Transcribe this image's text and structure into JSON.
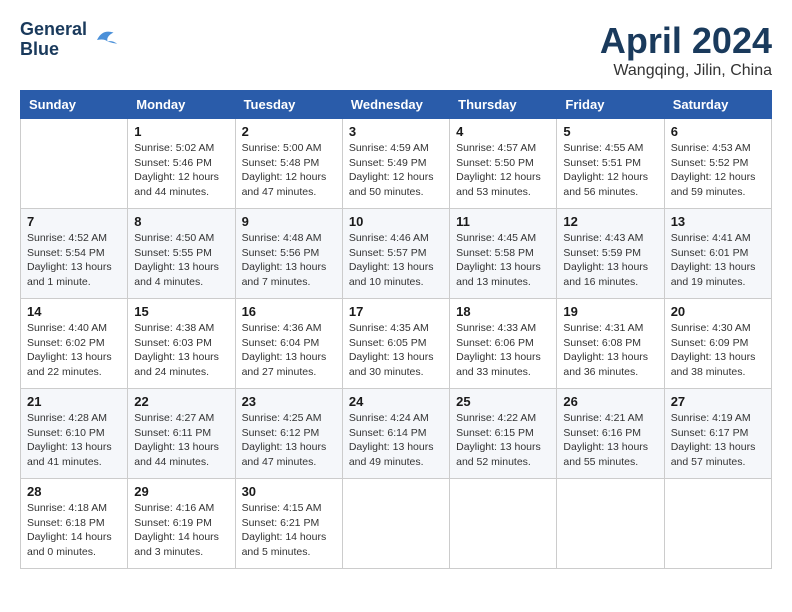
{
  "header": {
    "logo_line1": "General",
    "logo_line2": "Blue",
    "month": "April 2024",
    "location": "Wangqing, Jilin, China"
  },
  "columns": [
    "Sunday",
    "Monday",
    "Tuesday",
    "Wednesday",
    "Thursday",
    "Friday",
    "Saturday"
  ],
  "weeks": [
    [
      {
        "day": "",
        "sunrise": "",
        "sunset": "",
        "daylight": ""
      },
      {
        "day": "1",
        "sunrise": "Sunrise: 5:02 AM",
        "sunset": "Sunset: 5:46 PM",
        "daylight": "Daylight: 12 hours and 44 minutes."
      },
      {
        "day": "2",
        "sunrise": "Sunrise: 5:00 AM",
        "sunset": "Sunset: 5:48 PM",
        "daylight": "Daylight: 12 hours and 47 minutes."
      },
      {
        "day": "3",
        "sunrise": "Sunrise: 4:59 AM",
        "sunset": "Sunset: 5:49 PM",
        "daylight": "Daylight: 12 hours and 50 minutes."
      },
      {
        "day": "4",
        "sunrise": "Sunrise: 4:57 AM",
        "sunset": "Sunset: 5:50 PM",
        "daylight": "Daylight: 12 hours and 53 minutes."
      },
      {
        "day": "5",
        "sunrise": "Sunrise: 4:55 AM",
        "sunset": "Sunset: 5:51 PM",
        "daylight": "Daylight: 12 hours and 56 minutes."
      },
      {
        "day": "6",
        "sunrise": "Sunrise: 4:53 AM",
        "sunset": "Sunset: 5:52 PM",
        "daylight": "Daylight: 12 hours and 59 minutes."
      }
    ],
    [
      {
        "day": "7",
        "sunrise": "Sunrise: 4:52 AM",
        "sunset": "Sunset: 5:54 PM",
        "daylight": "Daylight: 13 hours and 1 minute."
      },
      {
        "day": "8",
        "sunrise": "Sunrise: 4:50 AM",
        "sunset": "Sunset: 5:55 PM",
        "daylight": "Daylight: 13 hours and 4 minutes."
      },
      {
        "day": "9",
        "sunrise": "Sunrise: 4:48 AM",
        "sunset": "Sunset: 5:56 PM",
        "daylight": "Daylight: 13 hours and 7 minutes."
      },
      {
        "day": "10",
        "sunrise": "Sunrise: 4:46 AM",
        "sunset": "Sunset: 5:57 PM",
        "daylight": "Daylight: 13 hours and 10 minutes."
      },
      {
        "day": "11",
        "sunrise": "Sunrise: 4:45 AM",
        "sunset": "Sunset: 5:58 PM",
        "daylight": "Daylight: 13 hours and 13 minutes."
      },
      {
        "day": "12",
        "sunrise": "Sunrise: 4:43 AM",
        "sunset": "Sunset: 5:59 PM",
        "daylight": "Daylight: 13 hours and 16 minutes."
      },
      {
        "day": "13",
        "sunrise": "Sunrise: 4:41 AM",
        "sunset": "Sunset: 6:01 PM",
        "daylight": "Daylight: 13 hours and 19 minutes."
      }
    ],
    [
      {
        "day": "14",
        "sunrise": "Sunrise: 4:40 AM",
        "sunset": "Sunset: 6:02 PM",
        "daylight": "Daylight: 13 hours and 22 minutes."
      },
      {
        "day": "15",
        "sunrise": "Sunrise: 4:38 AM",
        "sunset": "Sunset: 6:03 PM",
        "daylight": "Daylight: 13 hours and 24 minutes."
      },
      {
        "day": "16",
        "sunrise": "Sunrise: 4:36 AM",
        "sunset": "Sunset: 6:04 PM",
        "daylight": "Daylight: 13 hours and 27 minutes."
      },
      {
        "day": "17",
        "sunrise": "Sunrise: 4:35 AM",
        "sunset": "Sunset: 6:05 PM",
        "daylight": "Daylight: 13 hours and 30 minutes."
      },
      {
        "day": "18",
        "sunrise": "Sunrise: 4:33 AM",
        "sunset": "Sunset: 6:06 PM",
        "daylight": "Daylight: 13 hours and 33 minutes."
      },
      {
        "day": "19",
        "sunrise": "Sunrise: 4:31 AM",
        "sunset": "Sunset: 6:08 PM",
        "daylight": "Daylight: 13 hours and 36 minutes."
      },
      {
        "day": "20",
        "sunrise": "Sunrise: 4:30 AM",
        "sunset": "Sunset: 6:09 PM",
        "daylight": "Daylight: 13 hours and 38 minutes."
      }
    ],
    [
      {
        "day": "21",
        "sunrise": "Sunrise: 4:28 AM",
        "sunset": "Sunset: 6:10 PM",
        "daylight": "Daylight: 13 hours and 41 minutes."
      },
      {
        "day": "22",
        "sunrise": "Sunrise: 4:27 AM",
        "sunset": "Sunset: 6:11 PM",
        "daylight": "Daylight: 13 hours and 44 minutes."
      },
      {
        "day": "23",
        "sunrise": "Sunrise: 4:25 AM",
        "sunset": "Sunset: 6:12 PM",
        "daylight": "Daylight: 13 hours and 47 minutes."
      },
      {
        "day": "24",
        "sunrise": "Sunrise: 4:24 AM",
        "sunset": "Sunset: 6:14 PM",
        "daylight": "Daylight: 13 hours and 49 minutes."
      },
      {
        "day": "25",
        "sunrise": "Sunrise: 4:22 AM",
        "sunset": "Sunset: 6:15 PM",
        "daylight": "Daylight: 13 hours and 52 minutes."
      },
      {
        "day": "26",
        "sunrise": "Sunrise: 4:21 AM",
        "sunset": "Sunset: 6:16 PM",
        "daylight": "Daylight: 13 hours and 55 minutes."
      },
      {
        "day": "27",
        "sunrise": "Sunrise: 4:19 AM",
        "sunset": "Sunset: 6:17 PM",
        "daylight": "Daylight: 13 hours and 57 minutes."
      }
    ],
    [
      {
        "day": "28",
        "sunrise": "Sunrise: 4:18 AM",
        "sunset": "Sunset: 6:18 PM",
        "daylight": "Daylight: 14 hours and 0 minutes."
      },
      {
        "day": "29",
        "sunrise": "Sunrise: 4:16 AM",
        "sunset": "Sunset: 6:19 PM",
        "daylight": "Daylight: 14 hours and 3 minutes."
      },
      {
        "day": "30",
        "sunrise": "Sunrise: 4:15 AM",
        "sunset": "Sunset: 6:21 PM",
        "daylight": "Daylight: 14 hours and 5 minutes."
      },
      {
        "day": "",
        "sunrise": "",
        "sunset": "",
        "daylight": ""
      },
      {
        "day": "",
        "sunrise": "",
        "sunset": "",
        "daylight": ""
      },
      {
        "day": "",
        "sunrise": "",
        "sunset": "",
        "daylight": ""
      },
      {
        "day": "",
        "sunrise": "",
        "sunset": "",
        "daylight": ""
      }
    ]
  ]
}
